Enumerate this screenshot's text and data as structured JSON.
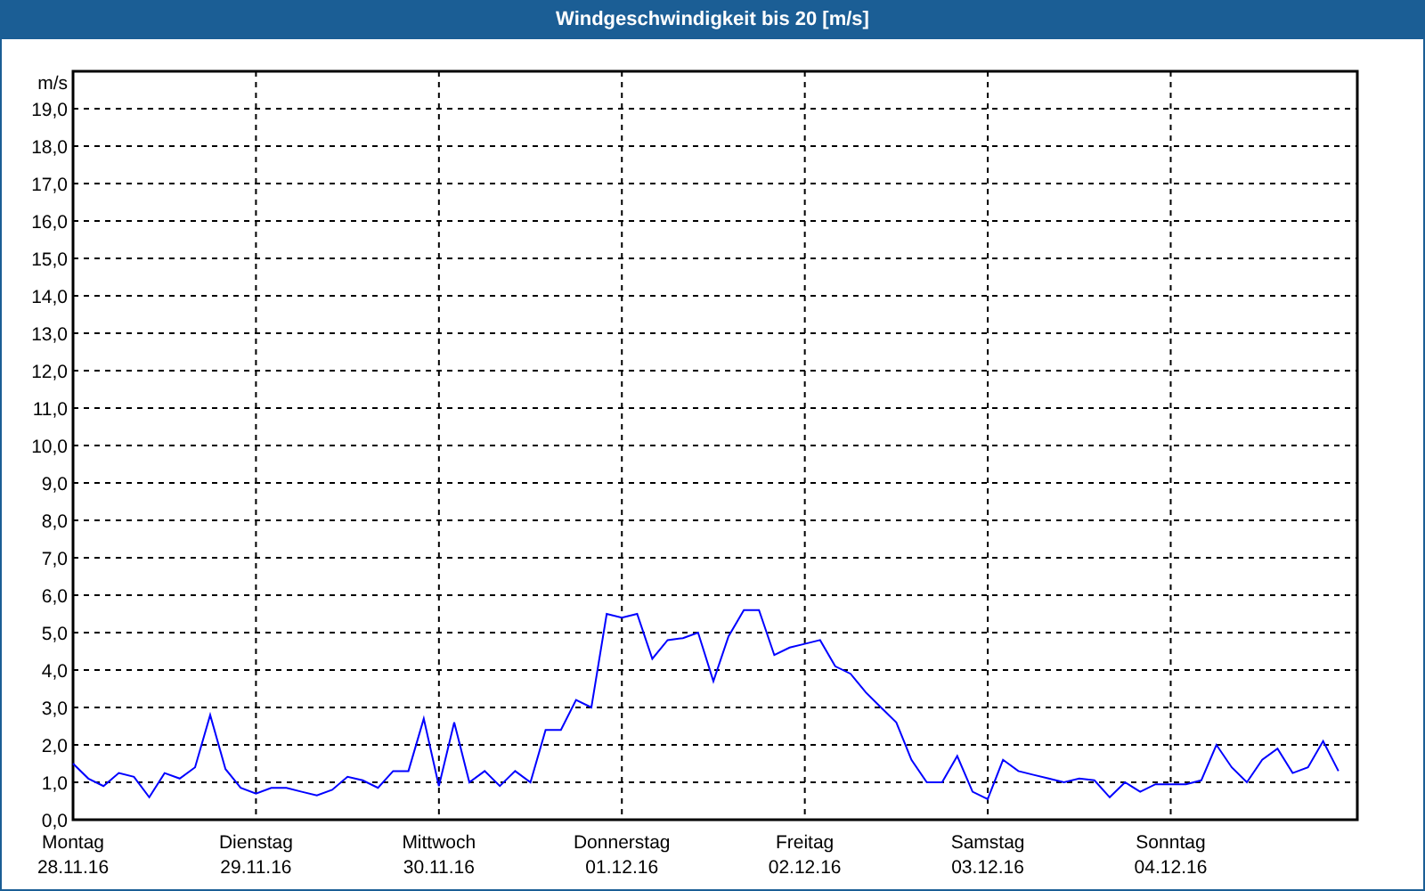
{
  "window": {
    "title": "Windgeschwindigkeit bis 20 [m/s]"
  },
  "chart": {
    "x_day_names": [
      "Montag",
      "Dienstag",
      "Mittwoch",
      "Donnerstag",
      "Freitag",
      "Samstag",
      "Sonntag"
    ],
    "chart_data": {
      "type": "line",
      "grid": true,
      "ylabel": "m/s",
      "ylim": [
        0,
        20
      ],
      "yticks": [
        {
          "value": 0,
          "label": "0,0"
        },
        {
          "value": 1,
          "label": "1,0"
        },
        {
          "value": 2,
          "label": "2,0"
        },
        {
          "value": 3,
          "label": "3,0"
        },
        {
          "value": 4,
          "label": "4,0"
        },
        {
          "value": 5,
          "label": "5,0"
        },
        {
          "value": 6,
          "label": "6,0"
        },
        {
          "value": 7,
          "label": "7,0"
        },
        {
          "value": 8,
          "label": "8,0"
        },
        {
          "value": 9,
          "label": "9,0"
        },
        {
          "value": 10,
          "label": "10,0"
        },
        {
          "value": 11,
          "label": "11,0"
        },
        {
          "value": 12,
          "label": "12,0"
        },
        {
          "value": 13,
          "label": "13,0"
        },
        {
          "value": 14,
          "label": "14,0"
        },
        {
          "value": 15,
          "label": "15,0"
        },
        {
          "value": 16,
          "label": "16,0"
        },
        {
          "value": 17,
          "label": "17,0"
        },
        {
          "value": 18,
          "label": "18,0"
        },
        {
          "value": 19,
          "label": "19,0"
        }
      ],
      "categories": [
        "28.11.16",
        null,
        null,
        null,
        null,
        null,
        null,
        null,
        null,
        null,
        null,
        null,
        "29.11.16",
        null,
        null,
        null,
        null,
        null,
        null,
        null,
        null,
        null,
        null,
        null,
        "30.11.16",
        null,
        null,
        null,
        null,
        null,
        null,
        null,
        null,
        null,
        null,
        null,
        "01.12.16",
        null,
        null,
        null,
        null,
        null,
        null,
        null,
        null,
        null,
        null,
        null,
        "02.12.16",
        null,
        null,
        null,
        null,
        null,
        null,
        null,
        null,
        null,
        null,
        null,
        "03.12.16",
        null,
        null,
        null,
        null,
        null,
        null,
        null,
        null,
        null,
        null,
        null,
        "04.12.16",
        null,
        null,
        null,
        null,
        null,
        null,
        null,
        null,
        null,
        null,
        null
      ],
      "series": [
        {
          "color": "#0000ff",
          "values": [
            1.5,
            1.1,
            0.9,
            1.25,
            1.15,
            0.6,
            1.25,
            1.1,
            1.4,
            2.8,
            1.35,
            0.85,
            0.7,
            0.85,
            0.85,
            0.75,
            0.65,
            0.8,
            1.15,
            1.05,
            0.85,
            1.3,
            1.3,
            2.7,
            0.9,
            2.6,
            1.0,
            1.3,
            0.9,
            1.3,
            1.0,
            2.4,
            2.4,
            3.2,
            3.0,
            5.5,
            5.4,
            5.5,
            4.3,
            4.8,
            4.85,
            5.0,
            3.7,
            4.9,
            5.6,
            5.6,
            4.4,
            4.6,
            4.7,
            4.8,
            4.1,
            3.9,
            3.4,
            3.0,
            2.6,
            1.6,
            1.0,
            1.0,
            1.7,
            0.75,
            0.55,
            1.6,
            1.3,
            1.2,
            1.1,
            1.0,
            1.1,
            1.05,
            0.6,
            1.0,
            0.75,
            0.95,
            0.95,
            0.95,
            1.05,
            2.0,
            1.4,
            1.0,
            1.6,
            1.9,
            1.25,
            1.4,
            2.1,
            1.3
          ]
        }
      ]
    }
  }
}
